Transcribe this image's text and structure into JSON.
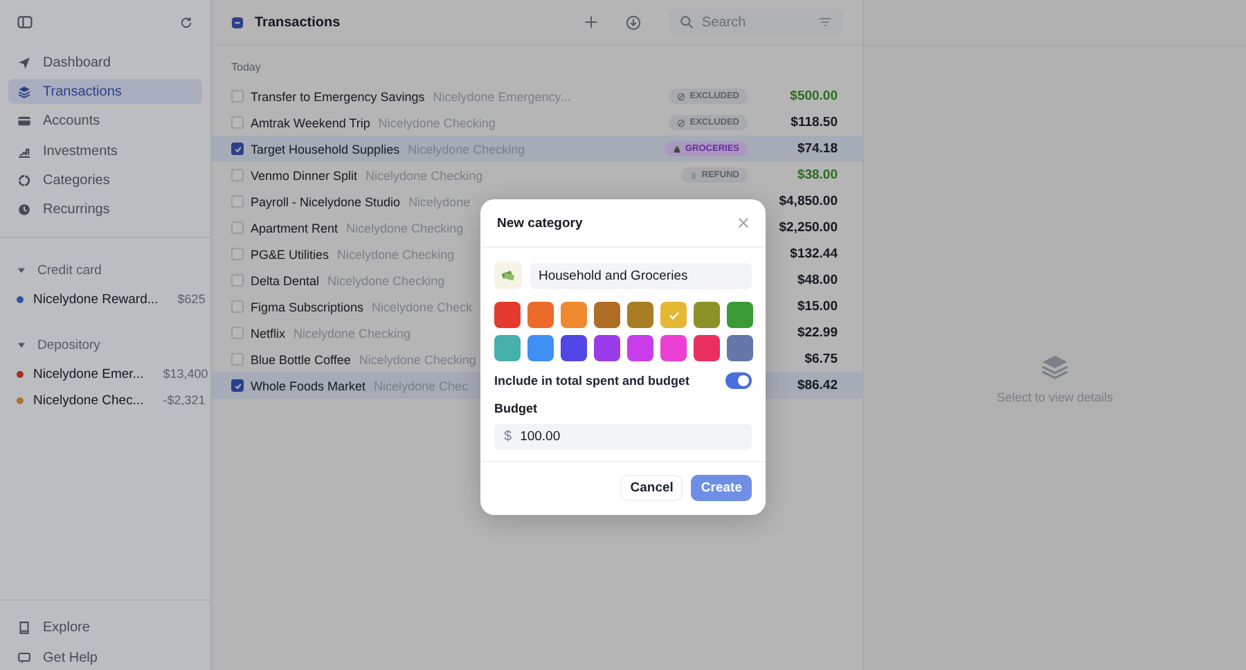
{
  "sidebar": {
    "nav": [
      {
        "label": "Dashboard",
        "selected": false
      },
      {
        "label": "Transactions",
        "selected": true
      },
      {
        "label": "Accounts",
        "selected": false
      },
      {
        "label": "Investments",
        "selected": false
      },
      {
        "label": "Categories",
        "selected": false
      },
      {
        "label": "Recurrings",
        "selected": false
      }
    ],
    "groups": [
      {
        "title": "Credit card",
        "expanded": true,
        "accounts": [
          {
            "name": "Nicelydone Reward...",
            "balance": "$625",
            "color": "#2f51a3"
          }
        ]
      },
      {
        "title": "Depository",
        "expanded": true,
        "accounts": [
          {
            "name": "Nicelydone Emer...",
            "balance": "$13,400",
            "color": "#a3302a"
          },
          {
            "name": "Nicelydone Chec...",
            "balance": "-$2,321",
            "color": "#b0702c"
          }
        ]
      }
    ],
    "footer": [
      {
        "label": "Explore"
      },
      {
        "label": "Get Help"
      }
    ]
  },
  "list": {
    "title": "Transactions",
    "select_all": {
      "indeterminate": true
    },
    "search": {
      "placeholder": "Search"
    },
    "section": "Today",
    "rows": [
      {
        "name": "Transfer to Emergency Savings",
        "account": "Nicelydone Emergency...",
        "tag": {
          "kind": "excluded",
          "label": "EXCLUDED"
        },
        "amount": "$500.00",
        "income": true,
        "selected": false
      },
      {
        "name": "Amtrak Weekend Trip",
        "account": "Nicelydone Checking",
        "tag": {
          "kind": "excluded",
          "label": "EXCLUDED"
        },
        "amount": "$118.50",
        "income": false,
        "selected": false
      },
      {
        "name": "Target Household Supplies",
        "account": "Nicelydone Checking",
        "tag": {
          "kind": "category",
          "label": "GROCERIES"
        },
        "amount": "$74.18",
        "income": false,
        "selected": true
      },
      {
        "name": "Venmo Dinner Split",
        "account": "Nicelydone Checking",
        "tag": {
          "kind": "refund",
          "label": "REFUND"
        },
        "amount": "$38.00",
        "income": true,
        "selected": false
      },
      {
        "name": "Payroll - Nicelydone Studio",
        "account": "Nicelydone",
        "amount": "$4,850.00",
        "income": false,
        "selected": false
      },
      {
        "name": "Apartment Rent",
        "account": "Nicelydone Checking",
        "amount": "$2,250.00",
        "income": false,
        "selected": false
      },
      {
        "name": "PG&E Utilities",
        "account": "Nicelydone Checking",
        "amount": "$132.44",
        "income": false,
        "selected": false
      },
      {
        "name": "Delta Dental",
        "account": "Nicelydone Checking",
        "amount": "$48.00",
        "income": false,
        "selected": false
      },
      {
        "name": "Figma Subscriptions",
        "account": "Nicelydone Check",
        "amount": "$15.00",
        "income": false,
        "selected": false
      },
      {
        "name": "Netflix",
        "account": "Nicelydone Checking",
        "amount": "$22.99",
        "income": false,
        "selected": false
      },
      {
        "name": "Blue Bottle Coffee",
        "account": "Nicelydone Checking",
        "amount": "$6.75",
        "income": false,
        "selected": false
      },
      {
        "name": "Whole Foods Market",
        "account": "Nicelydone Chec",
        "amount": "$86.42",
        "income": false,
        "selected": true
      }
    ]
  },
  "details": {
    "empty": "Select to view details"
  },
  "modal": {
    "title": "New category",
    "name": "Household and Groceries",
    "colors": [
      {
        "color": "#e53a2f",
        "selected": false
      },
      {
        "color": "#ec6a2a",
        "selected": false
      },
      {
        "color": "#ef8a2e",
        "selected": false
      },
      {
        "color": "#b06d26",
        "selected": false
      },
      {
        "color": "#a87d24",
        "selected": false
      },
      {
        "color": "#e5b834",
        "selected": true
      },
      {
        "color": "#8c9128",
        "selected": false
      },
      {
        "color": "#3a9a36",
        "selected": false
      },
      {
        "color": "#45b0ac",
        "selected": false
      },
      {
        "color": "#3f8ff5",
        "selected": false
      },
      {
        "color": "#5246e8",
        "selected": false
      },
      {
        "color": "#9a3ceb",
        "selected": false
      },
      {
        "color": "#c93cea",
        "selected": false
      },
      {
        "color": "#ec3fd3",
        "selected": false
      },
      {
        "color": "#e9305e",
        "selected": false
      },
      {
        "color": "#6477a8",
        "selected": false
      }
    ],
    "toggle": {
      "label": "Include in total spent and budget",
      "on": true
    },
    "budget": {
      "label": "Budget",
      "currency": "$",
      "value": "100.00"
    },
    "buttons": [
      {
        "kind": "secondary",
        "label": "Cancel"
      },
      {
        "kind": "primary",
        "label": "Create"
      }
    ]
  }
}
